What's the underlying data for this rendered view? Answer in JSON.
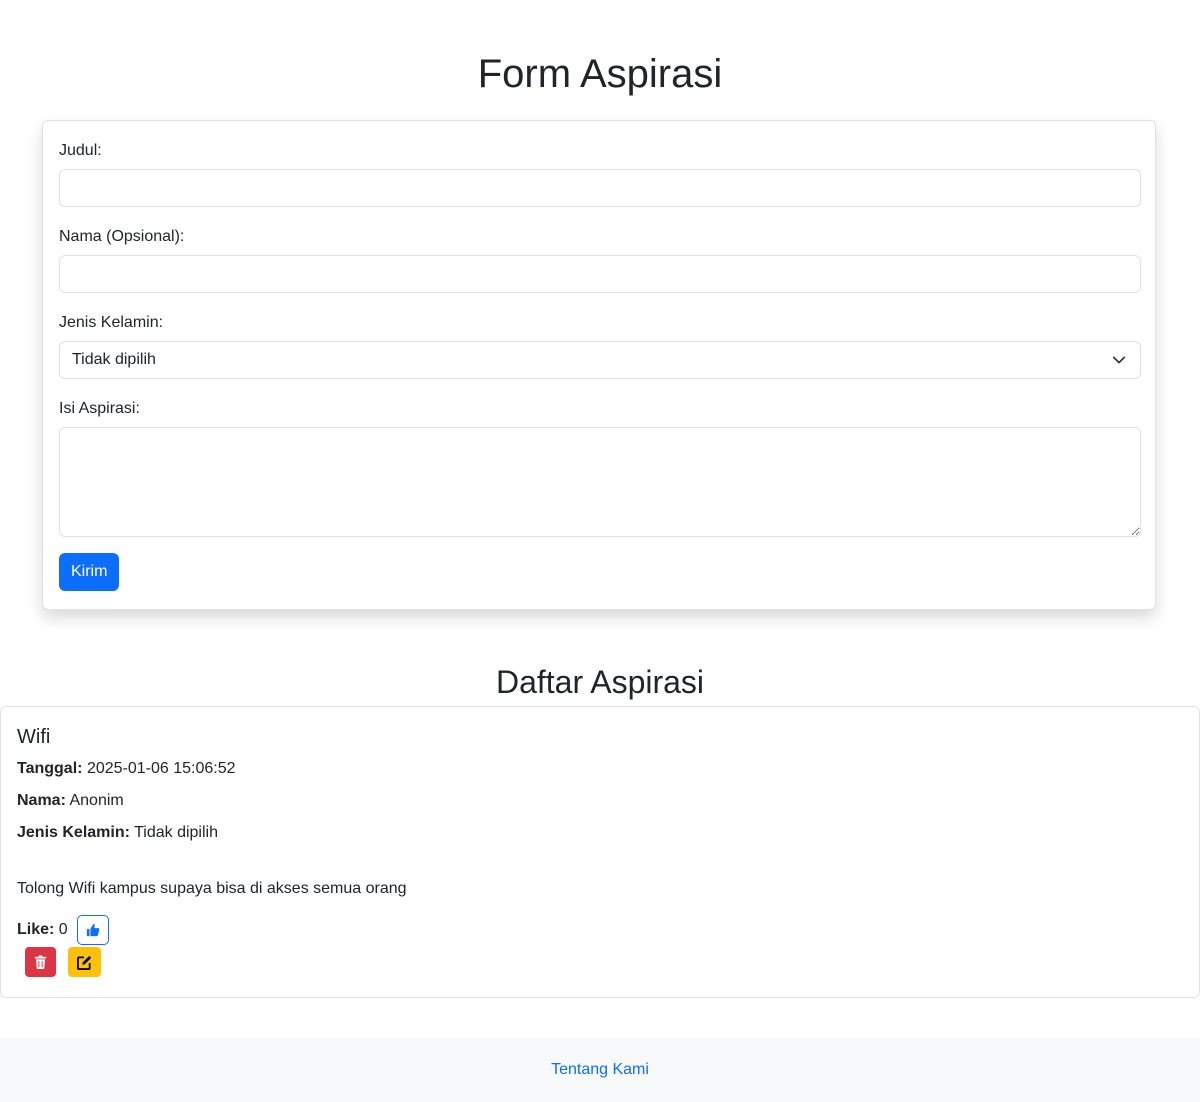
{
  "form": {
    "title": "Form Aspirasi",
    "judul_label": "Judul:",
    "judul_value": "",
    "nama_label": "Nama (Opsional):",
    "nama_value": "",
    "jenis_kelamin_label": "Jenis Kelamin:",
    "jenis_kelamin_selected": "Tidak dipilih",
    "isi_label": "Isi Aspirasi:",
    "isi_value": "",
    "submit_label": "Kirim"
  },
  "list": {
    "title": "Daftar Aspirasi",
    "items": [
      {
        "title": "Wifi",
        "tanggal_label": "Tanggal:",
        "tanggal": "2025-01-06 15:06:52",
        "nama_label": "Nama:",
        "nama": "Anonim",
        "jenis_kelamin_label": "Jenis Kelamin:",
        "jenis_kelamin": "Tidak dipilih",
        "isi": "Tolong Wifi kampus supaya bisa di akses semua orang",
        "like_label": "Like:",
        "like_count": "0",
        "icons": {
          "like": "thumbs-up-icon",
          "delete": "trash-icon",
          "edit": "edit-icon"
        }
      }
    ]
  },
  "footer": {
    "link_label": "Tentang Kami"
  },
  "colors": {
    "primary": "#0d6efd",
    "danger": "#dc3545",
    "warning": "#ffc107",
    "footer_bg": "#f8f9fa"
  }
}
